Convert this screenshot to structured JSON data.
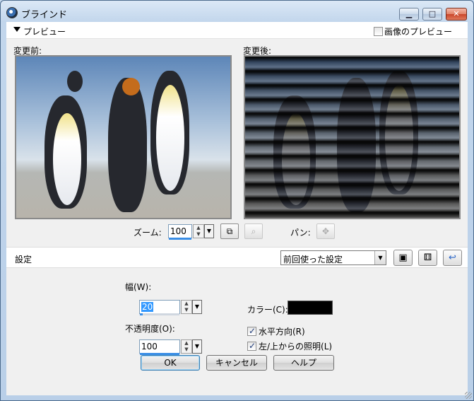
{
  "window": {
    "title": "ブラインド",
    "min_glyph": "▁",
    "max_glyph": "□",
    "close_glyph": "✕"
  },
  "preview": {
    "toggle_label": "プレビュー",
    "image_preview_label": "画像のプレビュー",
    "image_preview_checked": false,
    "before_label": "変更前:",
    "after_label": "変更後:"
  },
  "zoom": {
    "label": "ズーム:",
    "value": "100",
    "pan_label": "パン:"
  },
  "settings": {
    "label": "設定",
    "preset_value": "前回使った設定"
  },
  "params": {
    "width_label": "幅(W):",
    "width_value": "20",
    "opacity_label": "不透明度(O):",
    "opacity_value": "100",
    "color_label": "カラー(C):",
    "color_value": "#000000",
    "horizontal_label": "水平方向(R)",
    "horizontal_checked": true,
    "light_label": "左/上からの照明(L)",
    "light_checked": true
  },
  "buttons": {
    "ok": "OK",
    "cancel": "キャンセル",
    "help": "ヘルプ"
  }
}
